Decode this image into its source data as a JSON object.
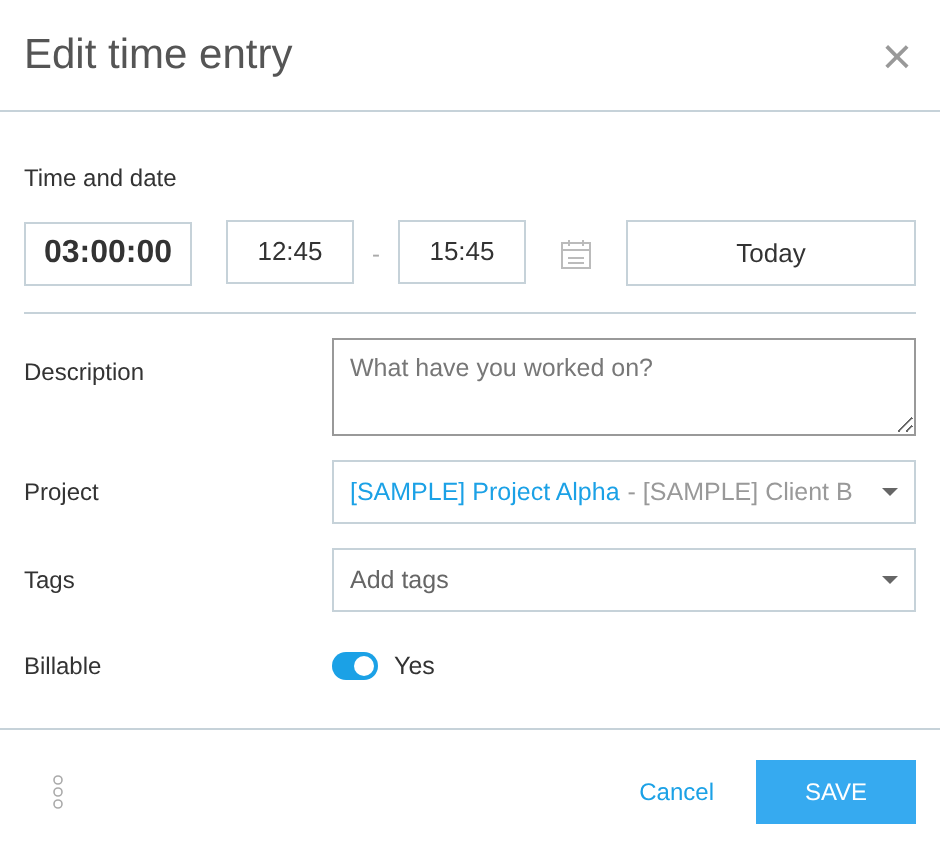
{
  "dialog": {
    "title": "Edit time entry",
    "close": "×"
  },
  "time_and_date": {
    "label": "Time and date",
    "duration": "03:00:00",
    "start": "12:45",
    "separator": "-",
    "end": "15:45",
    "date": "Today"
  },
  "description": {
    "label": "Description",
    "placeholder": "What have you worked on?"
  },
  "project": {
    "label": "Project",
    "name": "[SAMPLE] Project Alpha",
    "client": "- [SAMPLE] Client B"
  },
  "tags": {
    "label": "Tags",
    "placeholder": "Add tags"
  },
  "billable": {
    "label": "Billable",
    "on": true,
    "value": "Yes"
  },
  "footer": {
    "cancel": "Cancel",
    "save": "SAVE"
  }
}
